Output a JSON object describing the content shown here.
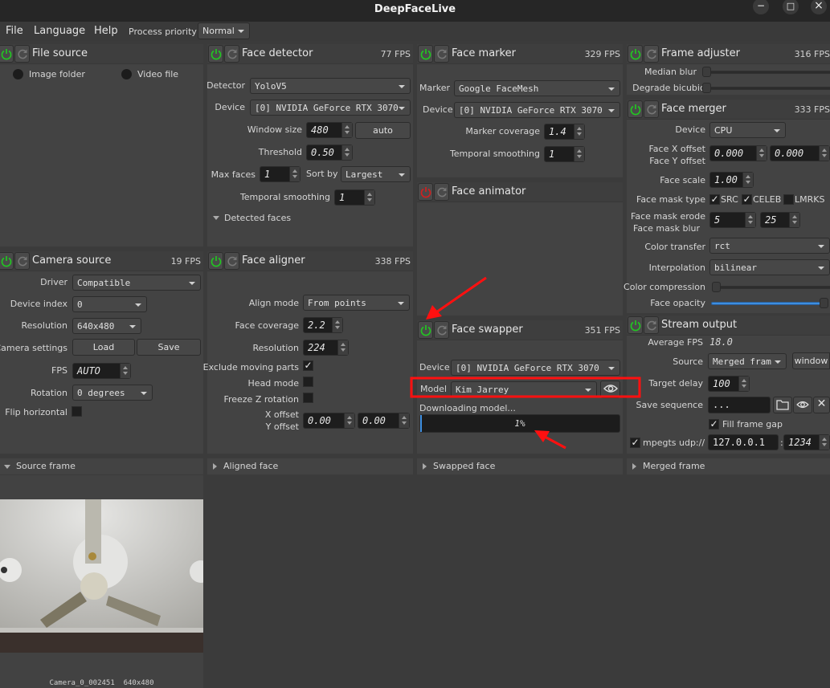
{
  "window": {
    "title": "DeepFaceLive",
    "minimize": "−",
    "maximize": "□",
    "close": "×"
  },
  "menu": {
    "file": "File",
    "language": "Language",
    "help": "Help",
    "process_priority_label": "Process priority",
    "process_priority": "Normal"
  },
  "colors": {
    "power_on": "#22c522",
    "power_off": "#d02020",
    "accent_blue": "#3d8ee0",
    "annotation_red": "#ff0000"
  },
  "file_source": {
    "title": "File source",
    "image_folder": "Image folder",
    "video_file": "Video file"
  },
  "face_detector": {
    "title": "Face detector",
    "fps": "77 FPS",
    "detector_label": "Detector",
    "detector": "YoloV5",
    "device_label": "Device",
    "device": "[0] NVIDIA GeForce RTX 3070",
    "window_size_label": "Window size",
    "window_size": "480",
    "auto": "auto",
    "threshold_label": "Threshold",
    "threshold": "0.50",
    "max_faces_label": "Max faces",
    "max_faces": "1",
    "sort_by_label": "Sort by",
    "sort_by": "Largest",
    "temporal_label": "Temporal smoothing",
    "temporal": "1",
    "detected_faces": "Detected faces"
  },
  "face_marker": {
    "title": "Face marker",
    "fps": "329 FPS",
    "marker_label": "Marker",
    "marker": "Google FaceMesh",
    "device_label": "Device",
    "device": "[0] NVIDIA GeForce RTX 3070",
    "coverage_label": "Marker coverage",
    "coverage": "1.4",
    "temporal_label": "Temporal smoothing",
    "temporal": "1"
  },
  "face_animator": {
    "title": "Face animator"
  },
  "face_swapper": {
    "title": "Face swapper",
    "fps": "351 FPS",
    "device_label": "Device",
    "device": "[0] NVIDIA GeForce RTX 3070",
    "model_label": "Model",
    "model": "Kim Jarrey",
    "status": "Downloading model...",
    "progress": "1%",
    "progress_value": 1
  },
  "frame_adjuster": {
    "title": "Frame adjuster",
    "fps": "316 FPS",
    "median_blur_label": "Median blur",
    "median_blur": 0,
    "degrade_label": "Degrade bicubic",
    "degrade": 0
  },
  "face_merger": {
    "title": "Face merger",
    "fps": "333 FPS",
    "device_label": "Device",
    "device": "CPU",
    "x_offset_label": "Face X offset",
    "y_offset_label": "Face Y offset",
    "x_offset": "0.000",
    "y_offset": "0.000",
    "scale_label": "Face scale",
    "scale": "1.00",
    "mask_type_label": "Face mask type",
    "mask_src": "SRC",
    "mask_celeb": "CELEB",
    "mask_lmrks": "LMRKS",
    "mask_src_checked": true,
    "mask_celeb_checked": true,
    "mask_lmrks_checked": false,
    "erode_label": "Face mask erode",
    "blur_label": "Face mask blur",
    "erode": "5",
    "blur": "25",
    "color_transfer_label": "Color transfer",
    "color_transfer": "rct",
    "interpolation_label": "Interpolation",
    "interpolation": "bilinear",
    "color_compression_label": "Color compression",
    "color_compression": 0,
    "opacity_label": "Face opacity",
    "opacity": 100
  },
  "stream_output": {
    "title": "Stream output",
    "avg_fps_label": "Average FPS",
    "avg_fps": "18.0",
    "source_label": "Source",
    "source": "Merged fram",
    "window": "window",
    "target_delay_label": "Target delay",
    "target_delay": "100",
    "save_seq_label": "Save sequence",
    "save_seq": "...",
    "fill_gap": "Fill frame gap",
    "mpegts": "mpegts udp://",
    "host": "127.0.0.1",
    "colon": ":",
    "port": "1234"
  },
  "camera_source": {
    "title": "Camera source",
    "fps": "19 FPS",
    "driver_label": "Driver",
    "driver": "Compatible",
    "device_index_label": "Device index",
    "device_index": "0",
    "resolution_label": "Resolution",
    "resolution": "640x480",
    "settings_label": "Camera settings",
    "load": "Load",
    "save": "Save",
    "fps_label": "FPS",
    "fps_value": "AUTO",
    "rotation_label": "Rotation",
    "rotation": "0 degrees",
    "flip_label": "Flip horizontal"
  },
  "face_aligner": {
    "title": "Face aligner",
    "fps": "338 FPS",
    "align_mode_label": "Align mode",
    "align_mode": "From points",
    "coverage_label": "Face coverage",
    "coverage": "2.2",
    "resolution_label": "Resolution",
    "resolution": "224",
    "exclude_label": "Exclude moving parts",
    "head_mode_label": "Head mode",
    "freeze_label": "Freeze Z rotation",
    "x_offset_label": "X offset",
    "y_offset_label": "Y offset",
    "x_offset": "0.00",
    "y_offset": "0.00"
  },
  "views": {
    "source_frame": "Source frame",
    "aligned_face": "Aligned face",
    "swapped_face": "Swapped face",
    "merged_frame": "Merged frame",
    "source_caption": "Camera_0_002451  640x480"
  }
}
